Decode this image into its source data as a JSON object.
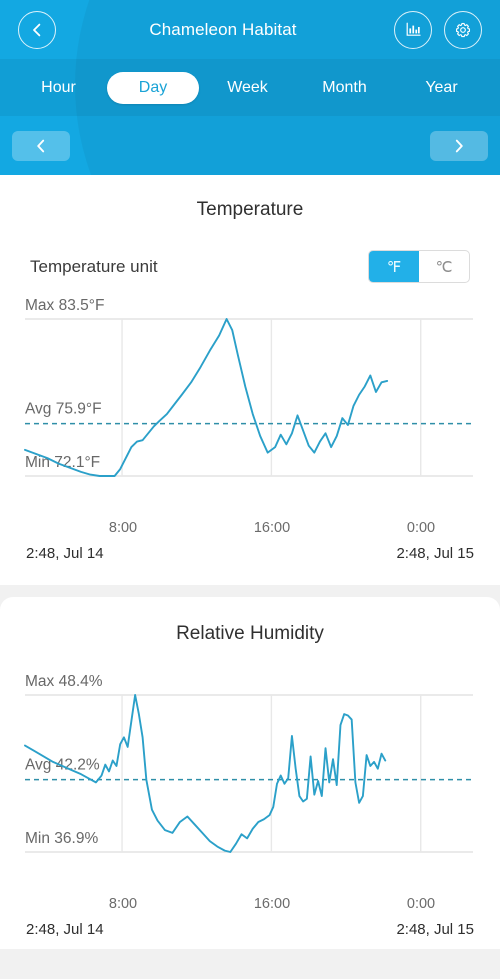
{
  "header": {
    "title": "Chameleon Habitat",
    "back_icon": "chevron-left-icon",
    "stats_icon": "bar-chart-icon",
    "settings_icon": "gear-icon",
    "tabs": [
      {
        "label": "Hour",
        "active": false
      },
      {
        "label": "Day",
        "active": true
      },
      {
        "label": "Week",
        "active": false
      },
      {
        "label": "Month",
        "active": false
      },
      {
        "label": "Year",
        "active": false
      }
    ],
    "prev_label": "‹",
    "next_label": "›",
    "accent": "#13a8e2",
    "tabbar_accent": "#0f9bd2"
  },
  "temperature": {
    "title": "Temperature",
    "unit_label": "Temperature unit",
    "unit_options": [
      "℉",
      "℃"
    ],
    "unit_selected": "℉",
    "max_label": "Max 83.5°F",
    "avg_label": "Avg 75.9°F",
    "min_label": "Min 72.1°F",
    "x_ticks": [
      "8:00",
      "16:00",
      "0:00"
    ],
    "range_start": "2:48,  Jul 14",
    "range_end": "2:48,  Jul 15"
  },
  "humidity": {
    "title": "Relative Humidity",
    "max_label": "Max 48.4%",
    "avg_label": "Avg 42.2%",
    "min_label": "Min 36.9%",
    "x_ticks": [
      "8:00",
      "16:00",
      "0:00"
    ],
    "range_start": "2:48,  Jul 14",
    "range_end": "2:48,  Jul 15"
  },
  "chart_data": [
    {
      "type": "line",
      "title": "Temperature",
      "ylabel": "°F",
      "xlabel": "",
      "ylim": [
        72.1,
        83.5
      ],
      "max": 83.5,
      "avg": 75.9,
      "min": 72.1,
      "unit": "°F",
      "grid": true,
      "legend": "none",
      "x_tick_labels": [
        "8:00",
        "16:00",
        "0:00"
      ],
      "x_tick_hours": [
        8,
        16,
        24
      ],
      "x_range_hours": [
        2.8,
        26.8
      ],
      "series": [
        {
          "name": "Temperature",
          "color": "#2ba0c9",
          "x_hours": [
            2.8,
            3.4,
            4.0,
            4.6,
            5.2,
            5.8,
            6.3,
            6.8,
            7.2,
            7.6,
            7.9,
            8.2,
            8.5,
            8.8,
            9.1,
            9.4,
            9.7,
            10.0,
            10.4,
            10.8,
            11.2,
            11.7,
            12.2,
            12.7,
            13.2,
            13.6,
            13.9,
            14.2,
            14.6,
            15.0,
            15.4,
            15.8,
            16.2,
            16.5,
            16.8,
            17.1,
            17.4,
            17.7,
            18.0,
            18.3,
            18.6,
            18.9,
            19.2,
            19.5,
            19.8,
            20.1,
            20.4,
            20.7,
            21.0,
            21.3,
            21.6,
            21.9,
            22.2
          ],
          "values": [
            74.0,
            73.7,
            73.4,
            73.0,
            72.7,
            72.4,
            72.2,
            72.1,
            72.1,
            72.1,
            72.6,
            73.4,
            74.2,
            74.6,
            74.7,
            75.2,
            75.7,
            76.1,
            76.6,
            77.3,
            78.0,
            78.9,
            80.0,
            81.2,
            82.3,
            83.5,
            82.7,
            80.9,
            78.6,
            76.6,
            75.0,
            73.8,
            74.2,
            75.1,
            74.4,
            75.2,
            76.5,
            75.4,
            74.3,
            73.8,
            74.6,
            75.2,
            74.2,
            75.0,
            76.3,
            75.8,
            77.2,
            78.0,
            78.6,
            79.4,
            78.2,
            78.9,
            79.0
          ]
        }
      ]
    },
    {
      "type": "line",
      "title": "Relative Humidity",
      "ylabel": "%",
      "xlabel": "",
      "ylim": [
        36.9,
        48.4
      ],
      "max": 48.4,
      "avg": 42.2,
      "min": 36.9,
      "unit": "%",
      "grid": true,
      "legend": "none",
      "x_tick_labels": [
        "8:00",
        "16:00",
        "0:00"
      ],
      "x_tick_hours": [
        8,
        16,
        24
      ],
      "x_range_hours": [
        2.8,
        26.8
      ],
      "series": [
        {
          "name": "Relative Humidity",
          "color": "#2ba0c9",
          "x_hours": [
            2.8,
            3.3,
            3.8,
            4.3,
            4.8,
            5.3,
            5.8,
            6.2,
            6.6,
            6.9,
            7.1,
            7.3,
            7.5,
            7.7,
            7.9,
            8.1,
            8.3,
            8.5,
            8.7,
            8.9,
            9.1,
            9.3,
            9.6,
            9.9,
            10.3,
            10.7,
            11.1,
            11.5,
            11.9,
            12.3,
            12.7,
            13.1,
            13.5,
            13.8,
            14.1,
            14.4,
            14.7,
            15.0,
            15.3,
            15.6,
            15.9,
            16.1,
            16.3,
            16.5,
            16.7,
            16.9,
            17.1,
            17.3,
            17.5,
            17.7,
            17.9,
            18.1,
            18.3,
            18.5,
            18.7,
            18.9,
            19.1,
            19.3,
            19.5,
            19.7,
            19.9,
            20.1,
            20.3,
            20.5,
            20.7,
            20.9,
            21.1,
            21.3,
            21.5,
            21.7,
            21.9,
            22.1
          ],
          "values": [
            44.7,
            44.3,
            43.9,
            43.5,
            43.2,
            42.9,
            42.6,
            42.3,
            42.0,
            42.5,
            43.3,
            42.8,
            43.6,
            43.2,
            44.8,
            45.3,
            44.6,
            46.5,
            48.4,
            47.0,
            45.3,
            42.2,
            40.0,
            39.2,
            38.5,
            38.3,
            39.1,
            39.5,
            38.9,
            38.3,
            37.7,
            37.3,
            37.0,
            36.9,
            37.5,
            38.2,
            37.9,
            38.6,
            39.1,
            39.3,
            39.6,
            40.2,
            41.9,
            42.5,
            41.9,
            42.3,
            45.4,
            43.0,
            41.0,
            40.6,
            40.8,
            43.9,
            41.1,
            42.1,
            41.0,
            44.5,
            42.0,
            43.7,
            41.8,
            46.2,
            47.0,
            46.9,
            46.6,
            42.0,
            40.5,
            41.0,
            44.0,
            43.2,
            43.5,
            43.0,
            44.1,
            43.6
          ]
        }
      ]
    }
  ]
}
